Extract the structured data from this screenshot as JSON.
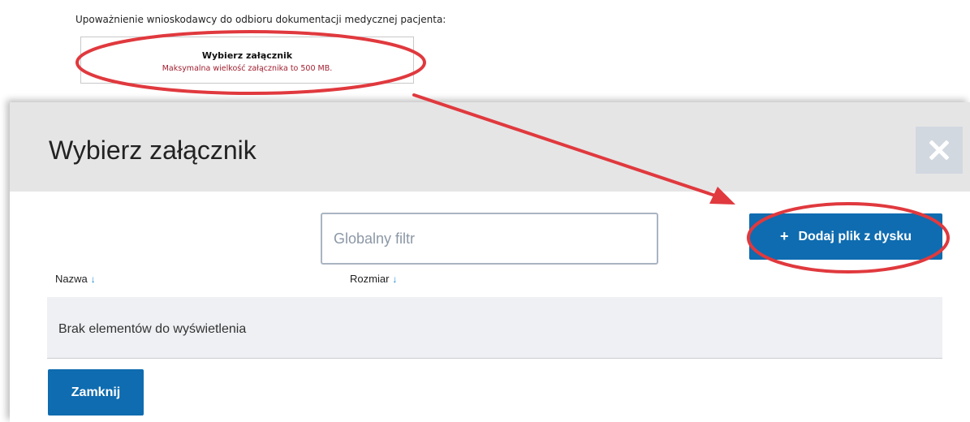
{
  "form": {
    "label": "Upoważnienie wnioskodawcy do odbioru dokumentacji medycznej pacjenta:",
    "attachment_box": {
      "title": "Wybierz załącznik",
      "hint": "Maksymalna wielkość załącznika to 500 MB."
    }
  },
  "modal": {
    "title": "Wybierz załącznik",
    "close_icon": "close-icon",
    "filter": {
      "placeholder": "Globalny filtr",
      "value": ""
    },
    "add_button": {
      "icon": "+",
      "label": "Dodaj plik z dysku"
    },
    "table": {
      "columns": [
        {
          "label": "Nazwa",
          "sort_icon": "↓"
        },
        {
          "label": "Rozmiar",
          "sort_icon": "↓"
        }
      ],
      "empty_message": "Brak elementów do wyświetlenia"
    },
    "footer": {
      "close_label": "Zamknij"
    }
  },
  "colors": {
    "primary_button": "#0f6cb0",
    "header_bg": "#e5e5e5",
    "close_button_bg": "#d2d8e0",
    "annotation_red": "#e0393e",
    "hint_text": "#a02030",
    "sort_arrow": "#1a86d6"
  }
}
